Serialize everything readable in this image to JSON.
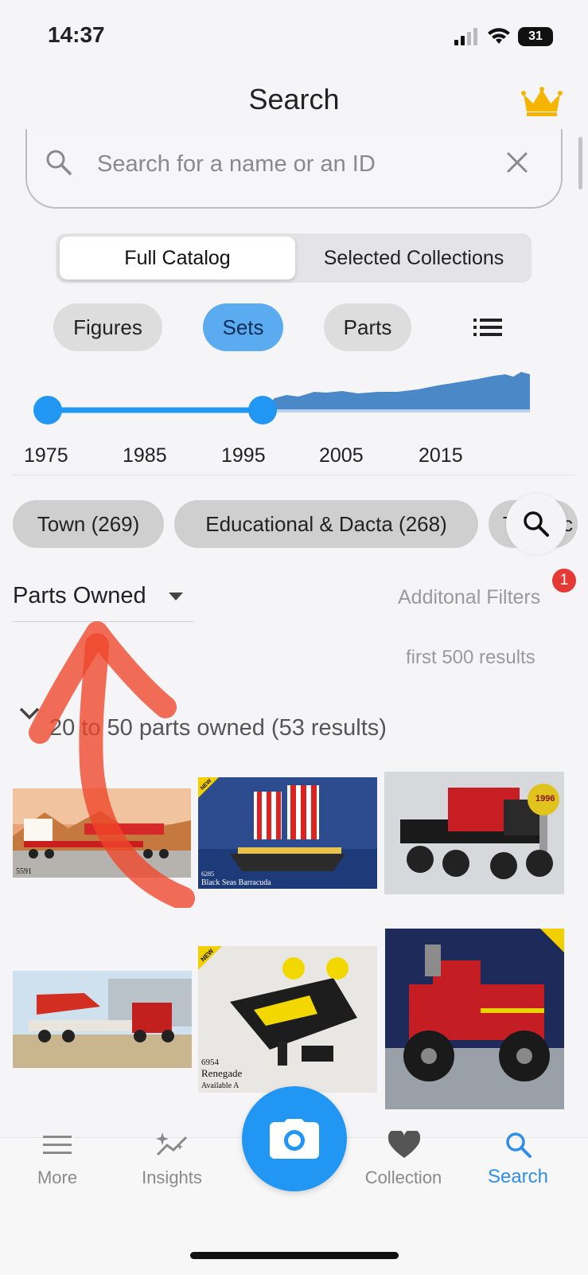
{
  "status_bar": {
    "time": "14:37",
    "battery": "31"
  },
  "header": {
    "title": "Search"
  },
  "search": {
    "placeholder": "Search for a name or an ID"
  },
  "catalog_toggle": {
    "options": [
      "Full Catalog",
      "Selected Collections"
    ],
    "selected": "Full Catalog"
  },
  "type_chips": [
    {
      "label": "Figures",
      "selected": false
    },
    {
      "label": "Sets",
      "selected": true
    },
    {
      "label": "Parts",
      "selected": false
    }
  ],
  "year_filter": {
    "ticks": [
      "1975",
      "1985",
      "1995",
      "2005",
      "2015"
    ],
    "selected_range": [
      "1975",
      "1995"
    ]
  },
  "theme_chips": [
    "Town (269)",
    "Educational & Dacta (268)",
    "Technic"
  ],
  "filters": {
    "sort_label": "Parts Owned",
    "additional_filters_label": "Additonal Filters",
    "badge_count": "1"
  },
  "results": {
    "limit_note": "first 500 results",
    "group_label": "20 to 50 parts owned (53 results)"
  },
  "thumbnails": [
    {
      "caption": "5591"
    },
    {
      "caption_number": "6285",
      "caption_name": "Black Seas Barracuda",
      "tag": "NEW"
    },
    {
      "badge": "1996"
    },
    {
      "caption": ""
    },
    {
      "caption_number": "6954",
      "caption_name": "Renegade",
      "caption_extra": "Available A",
      "tag": "NEW"
    },
    {
      "caption": ""
    }
  ],
  "bottom_nav": [
    {
      "label": "More",
      "icon": "menu-icon"
    },
    {
      "label": "Insights",
      "icon": "insights-icon"
    },
    {
      "label": "Collection",
      "icon": "heart-icon"
    },
    {
      "label": "Search",
      "icon": "search-icon",
      "active": true
    }
  ],
  "colors": {
    "accent": "#2196f3",
    "chip_selected": "#5aabf0",
    "badge": "#e53935",
    "crown": "#f4b400"
  }
}
